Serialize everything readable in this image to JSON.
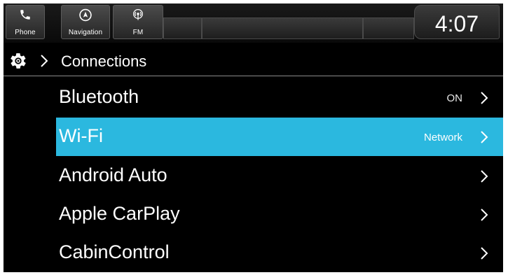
{
  "topbar": {
    "tabs": [
      {
        "label": "Phone",
        "icon": "phone-icon"
      },
      {
        "label": "Navigation",
        "icon": "navigation-icon"
      },
      {
        "label": "FM",
        "icon": "radio-icon"
      }
    ],
    "clock": "4:07"
  },
  "header": {
    "settings_icon": "gear-icon",
    "title": "Connections"
  },
  "list": {
    "items": [
      {
        "label": "Bluetooth",
        "value": "ON",
        "selected": false
      },
      {
        "label": "Wi-Fi",
        "value": "Network",
        "selected": true
      },
      {
        "label": "Android Auto",
        "value": "",
        "selected": false
      },
      {
        "label": "Apple CarPlay",
        "value": "",
        "selected": false
      },
      {
        "label": "CabinControl",
        "value": "",
        "selected": false
      }
    ]
  },
  "colors": {
    "background": "#000000",
    "selection": "#2bb8df",
    "text": "#ffffff"
  }
}
